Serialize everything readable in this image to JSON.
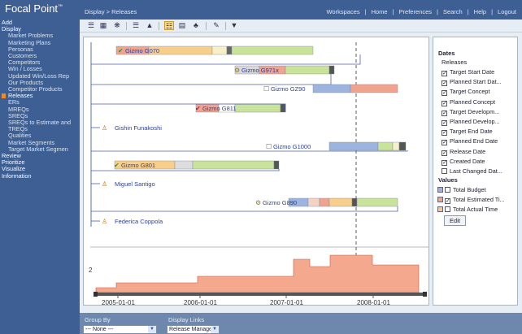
{
  "app": {
    "title": "Focal Point",
    "trademark": "™"
  },
  "breadcrumb": "Display > Releases",
  "top_links": [
    "Workspaces",
    "Home",
    "Preferences",
    "Search",
    "Help",
    "Logout"
  ],
  "sidebar": {
    "items": [
      {
        "label": "Add",
        "level": 0
      },
      {
        "label": "Display",
        "level": 0
      },
      {
        "label": "Market Problems",
        "level": 1
      },
      {
        "label": "Marketing Plans",
        "level": 1
      },
      {
        "label": "Personas",
        "level": 1
      },
      {
        "label": "Customers",
        "level": 1
      },
      {
        "label": "Competitors",
        "level": 1
      },
      {
        "label": "Win / Losses",
        "level": 1
      },
      {
        "label": "Updated Win/Loss Rep",
        "level": 1
      },
      {
        "label": "Our Products",
        "level": 1
      },
      {
        "label": "Competitor Products",
        "level": 1
      },
      {
        "label": "Releases",
        "level": 1,
        "selected": true
      },
      {
        "label": "ERs",
        "level": 1
      },
      {
        "label": "MREQs",
        "level": 1
      },
      {
        "label": "SREQs",
        "level": 1
      },
      {
        "label": "SREQs to Estimate and",
        "level": 1
      },
      {
        "label": "TREQs",
        "level": 1
      },
      {
        "label": "Qualities",
        "level": 1
      },
      {
        "label": "Market Segments",
        "level": 1
      },
      {
        "label": "Target Market Segmen",
        "level": 1
      },
      {
        "label": "Review",
        "level": 0
      },
      {
        "label": "Prioritize",
        "level": 0
      },
      {
        "label": "Visualize",
        "level": 0
      },
      {
        "label": "Information",
        "level": 0
      }
    ]
  },
  "toolbar": {
    "icons": [
      "hierarchy-icon",
      "table-icon",
      "network-icon",
      "align-left-icon",
      "chart-icon",
      "highlight-icon",
      "filter-bars-icon",
      "group-icon",
      "edit-icon",
      "filter-icon"
    ]
  },
  "gantt": {
    "releases": [
      {
        "label": "Gizmo G070",
        "marker": "check",
        "row": 0
      },
      {
        "label": "Gizmo G971x",
        "marker": "gear",
        "row": 1
      },
      {
        "label": "Gizmo GZ90",
        "marker": "box",
        "row": 2
      },
      {
        "label": "Gizmo G811",
        "marker": "check-red",
        "row": 3
      },
      {
        "label": "Gishin Funakoshi",
        "marker": "person",
        "row": 4
      },
      {
        "label": "Gizmo G1000",
        "marker": "box",
        "row": 5
      },
      {
        "label": "Gizmo G801",
        "marker": "check",
        "row": 6
      },
      {
        "label": "Miguel Santigo",
        "marker": "person",
        "row": 7
      },
      {
        "label": "Gizmo G890",
        "marker": "gear",
        "row": 8
      },
      {
        "label": "Federica Coppola",
        "marker": "person",
        "row": 9
      }
    ],
    "axis_labels": [
      "2005-01-01",
      "2006-01-01",
      "2007-01-01",
      "2008-01-01"
    ],
    "histogram_y_label": "2"
  },
  "legend": {
    "dates_title": "Dates",
    "releases_title": "Releases",
    "dates": [
      {
        "label": "Target Start Date",
        "checked": true
      },
      {
        "label": "Planned Start Dat...",
        "checked": true
      },
      {
        "label": "Target Concept",
        "checked": true
      },
      {
        "label": "Planned Concept",
        "checked": true
      },
      {
        "label": "Target Developm...",
        "checked": true
      },
      {
        "label": "Planned Develop...",
        "checked": true
      },
      {
        "label": "Target End Date",
        "checked": true
      },
      {
        "label": "Planned End Date",
        "checked": true
      },
      {
        "label": "Release Date",
        "checked": true
      },
      {
        "label": "Created Date",
        "checked": true
      },
      {
        "label": "Last Changed Dat...",
        "checked": false
      }
    ],
    "values_title": "Values",
    "values": [
      {
        "label": "Total Budget",
        "checked": false,
        "color": "#9db4de"
      },
      {
        "label": "Total Estimated Ti...",
        "checked": true,
        "color": "#f0a48e"
      },
      {
        "label": "Total Actual Time",
        "checked": false,
        "color": "#f6c88e"
      }
    ],
    "edit_label": "Edit"
  },
  "bottom": {
    "group_by_label": "Group By",
    "group_by_value": "--- None ---",
    "display_links_label": "Display Links",
    "display_links_value": "Release Manager"
  },
  "colors": {
    "header": "#3d5f94",
    "accent": "#f08a24",
    "bar_green": "#c9e39a",
    "bar_orange": "#f8cf8a",
    "bar_blue": "#9db4de",
    "bar_salmon": "#f0a48e"
  }
}
